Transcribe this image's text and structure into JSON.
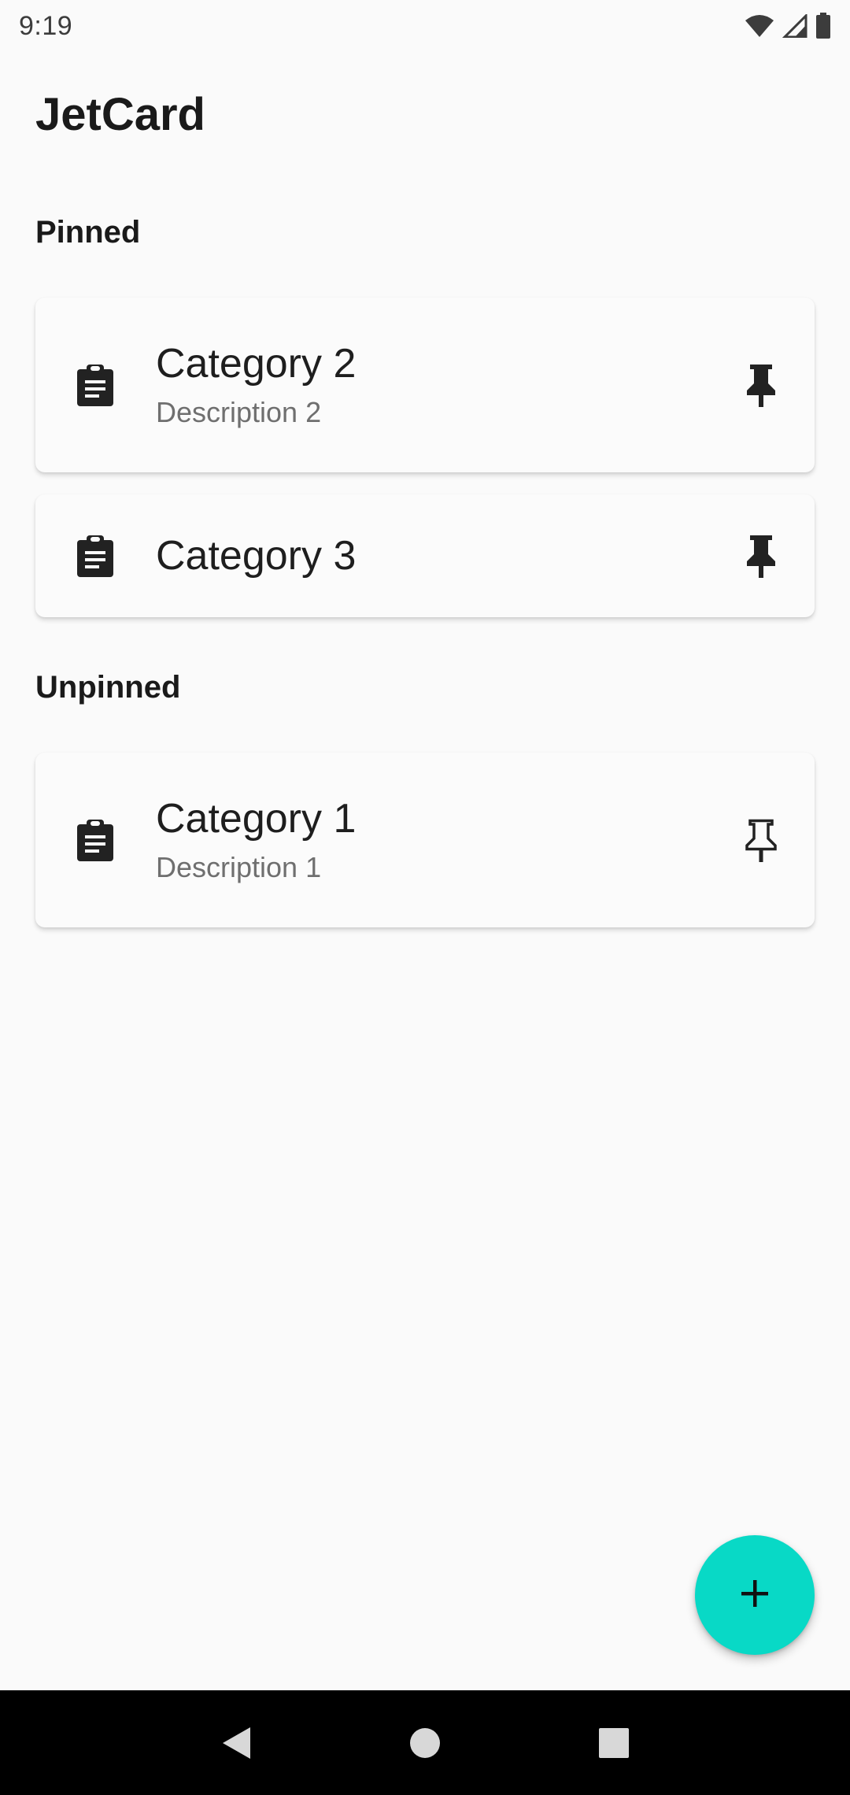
{
  "status_bar": {
    "time": "9:19",
    "icons": [
      "wifi-icon",
      "signal-icon",
      "battery-icon"
    ]
  },
  "app": {
    "title": "JetCard"
  },
  "sections": {
    "pinned_label": "Pinned",
    "unpinned_label": "Unpinned"
  },
  "cards": [
    {
      "title": "Category 2",
      "description": "Description 2",
      "icon": "clipboard-icon",
      "pinned": true
    },
    {
      "title": "Category 3",
      "description": "",
      "icon": "clipboard-icon",
      "pinned": true
    },
    {
      "title": "Category 1",
      "description": "Description 1",
      "icon": "clipboard-icon",
      "pinned": false
    }
  ],
  "fab": {
    "icon": "plus-icon",
    "color": "#08d9c6"
  },
  "nav_bar": {
    "icons": [
      "back-icon",
      "home-icon",
      "recents-icon"
    ]
  }
}
